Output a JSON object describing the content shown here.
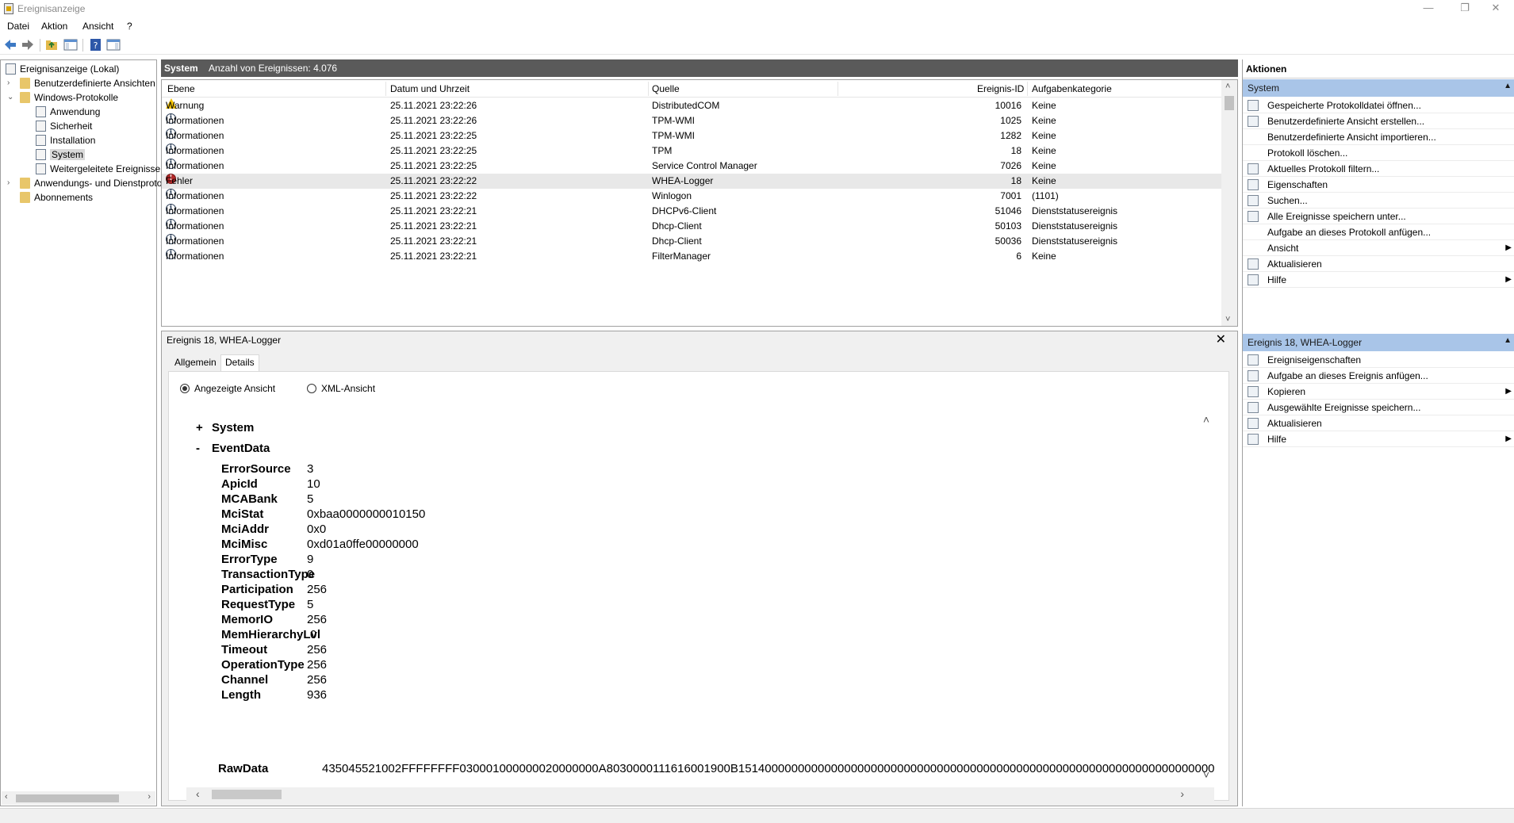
{
  "window": {
    "title": "Ereignisanzeige",
    "minimize": "—",
    "restore": "❐",
    "close": "✕"
  },
  "menu": [
    "Datei",
    "Aktion",
    "Ansicht",
    "?"
  ],
  "tree": {
    "root": "Ereignisanzeige (Lokal)",
    "custom_views": "Benutzerdefinierte Ansichten",
    "windows_logs": "Windows-Protokolle",
    "application": "Anwendung",
    "security": "Sicherheit",
    "setup": "Installation",
    "system": "System",
    "forwarded": "Weitergeleitete Ereignisse",
    "apps_services": "Anwendungs- und Dienstprotokolle",
    "subscriptions": "Abonnements"
  },
  "list": {
    "title": "System",
    "count_label": "Anzahl von Ereignissen: 4.076",
    "columns": [
      "Ebene",
      "Datum und Uhrzeit",
      "Quelle",
      "Ereignis-ID",
      "Aufgabenkategorie"
    ],
    "rows": [
      {
        "level": "Warnung",
        "icon": "warning-icon",
        "date": "25.11.2021 23:22:26",
        "source": "DistributedCOM",
        "id": "10016",
        "category": "Keine"
      },
      {
        "level": "Informationen",
        "icon": "info-icon",
        "date": "25.11.2021 23:22:26",
        "source": "TPM-WMI",
        "id": "1025",
        "category": "Keine"
      },
      {
        "level": "Informationen",
        "icon": "info-icon",
        "date": "25.11.2021 23:22:25",
        "source": "TPM-WMI",
        "id": "1282",
        "category": "Keine"
      },
      {
        "level": "Informationen",
        "icon": "info-icon",
        "date": "25.11.2021 23:22:25",
        "source": "TPM",
        "id": "18",
        "category": "Keine"
      },
      {
        "level": "Informationen",
        "icon": "info-icon",
        "date": "25.11.2021 23:22:25",
        "source": "Service Control Manager",
        "id": "7026",
        "category": "Keine"
      },
      {
        "level": "Fehler",
        "icon": "error-icon",
        "date": "25.11.2021 23:22:22",
        "source": "WHEA-Logger",
        "id": "18",
        "category": "Keine"
      },
      {
        "level": "Informationen",
        "icon": "info-icon",
        "date": "25.11.2021 23:22:22",
        "source": "Winlogon",
        "id": "7001",
        "category": "(1101)"
      },
      {
        "level": "Informationen",
        "icon": "info-icon",
        "date": "25.11.2021 23:22:21",
        "source": "DHCPv6-Client",
        "id": "51046",
        "category": "Dienststatusereignis"
      },
      {
        "level": "Informationen",
        "icon": "info-icon",
        "date": "25.11.2021 23:22:21",
        "source": "Dhcp-Client",
        "id": "50103",
        "category": "Dienststatusereignis"
      },
      {
        "level": "Informationen",
        "icon": "info-icon",
        "date": "25.11.2021 23:22:21",
        "source": "Dhcp-Client",
        "id": "50036",
        "category": "Dienststatusereignis"
      },
      {
        "level": "Informationen",
        "icon": "info-icon",
        "date": "25.11.2021 23:22:21",
        "source": "FilterManager",
        "id": "6",
        "category": "Keine"
      }
    ]
  },
  "detail": {
    "title": "Ereignis 18, WHEA-Logger",
    "tabs": [
      "Allgemein",
      "Details"
    ],
    "view_friendly": "Angezeigte Ansicht",
    "view_xml": "XML-Ansicht",
    "system_toggle": "+",
    "system_label": "System",
    "eventdata_toggle": "-",
    "eventdata_label": "EventData",
    "fields": [
      {
        "key": "ErrorSource",
        "value": "3"
      },
      {
        "key": "ApicId",
        "value": "10"
      },
      {
        "key": "MCABank",
        "value": "5"
      },
      {
        "key": "MciStat",
        "value": "0xbaa0000000010150"
      },
      {
        "key": "MciAddr",
        "value": "0x0"
      },
      {
        "key": "MciMisc",
        "value": "0xd01a0ffe00000000"
      },
      {
        "key": "ErrorType",
        "value": "9"
      },
      {
        "key": "TransactionType",
        "value": "0"
      },
      {
        "key": "Participation",
        "value": "256"
      },
      {
        "key": "RequestType",
        "value": "5"
      },
      {
        "key": "MemorIO",
        "value": "256"
      },
      {
        "key": "MemHierarchyLvl",
        "value": "0"
      },
      {
        "key": "Timeout",
        "value": "256"
      },
      {
        "key": "OperationType",
        "value": "256"
      },
      {
        "key": "Channel",
        "value": "256"
      },
      {
        "key": "Length",
        "value": "936"
      }
    ],
    "rawdata_key": "RawData",
    "rawdata_value": "435045521002FFFFFFFF030001000000020000000A8030000111616001900B151400000000000000000000000000000000000000000000000000000000000000000000"
  },
  "actions": {
    "title": "Aktionen",
    "section1": "System",
    "items1": [
      {
        "label": "Gespeicherte Protokolldatei öffnen...",
        "icon": "open-folder-icon"
      },
      {
        "label": "Benutzerdefinierte Ansicht erstellen...",
        "icon": "filter-create-icon"
      },
      {
        "label": "Benutzerdefinierte Ansicht importieren...",
        "icon": ""
      },
      {
        "label": "Protokoll löschen...",
        "icon": ""
      },
      {
        "label": "Aktuelles Protokoll filtern...",
        "icon": "filter-icon"
      },
      {
        "label": "Eigenschaften",
        "icon": "properties-icon"
      },
      {
        "label": "Suchen...",
        "icon": "binoculars-icon"
      },
      {
        "label": "Alle Ereignisse speichern unter...",
        "icon": "save-icon"
      },
      {
        "label": "Aufgabe an dieses Protokoll anfügen...",
        "icon": ""
      },
      {
        "label": "Ansicht",
        "icon": "",
        "submenu": true
      },
      {
        "label": "Aktualisieren",
        "icon": "refresh-icon"
      },
      {
        "label": "Hilfe",
        "icon": "help-icon",
        "submenu": true
      }
    ],
    "section2": "Ereignis 18, WHEA-Logger",
    "items2": [
      {
        "label": "Ereigniseigenschaften",
        "icon": "event-properties-icon"
      },
      {
        "label": "Aufgabe an dieses Ereignis anfügen...",
        "icon": "task-icon"
      },
      {
        "label": "Kopieren",
        "icon": "copy-icon",
        "submenu": true
      },
      {
        "label": "Ausgewählte Ereignisse speichern...",
        "icon": "save-icon"
      },
      {
        "label": "Aktualisieren",
        "icon": "refresh-icon"
      },
      {
        "label": "Hilfe",
        "icon": "help-icon",
        "submenu": true
      }
    ]
  },
  "colors": {
    "list_header_bg": "#5a5a5a",
    "action_section_bg": "#a9c5e8",
    "selected_row_bg": "#e8e8e8"
  }
}
